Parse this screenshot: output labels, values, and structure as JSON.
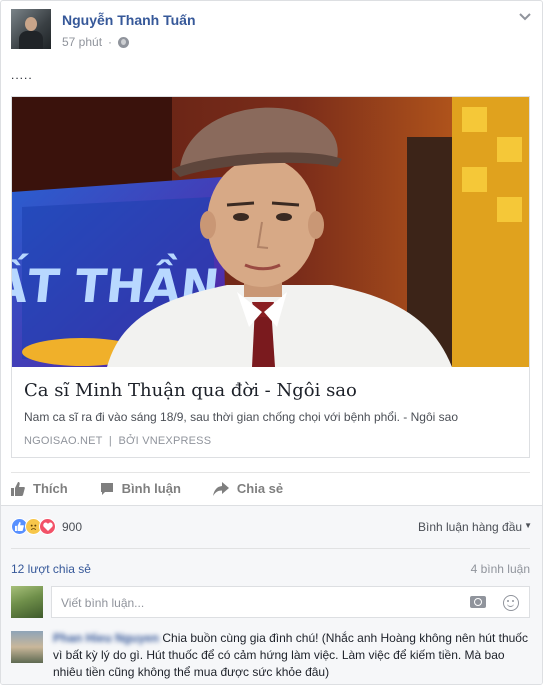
{
  "post": {
    "author": "Nguyễn Thanh Tuấn",
    "time": "57 phút",
    "text": ".....",
    "link": {
      "title": "Ca sĩ Minh Thuận qua đời - Ngôi sao",
      "description": "Nam ca sĩ ra đi vào sáng 18/9, sau thời gian chống chọi với bệnh phổi. - Ngôi sao",
      "source": "NGOISAO.NET",
      "via": "BỞI VNEXPRESS",
      "image_text": "ẤT THẦN"
    }
  },
  "actions": {
    "like": "Thích",
    "comment": "Bình luận",
    "share": "Chia sẻ"
  },
  "reactions": {
    "types": [
      "like",
      "sad",
      "love"
    ],
    "count": "900"
  },
  "sort_label": "Bình luận hàng đầu",
  "shares_label": "12 lượt chia sẻ",
  "comments_label": "4 bình luận",
  "composer_placeholder": "Viết bình luận...",
  "comment": {
    "author": "Phan Hieu Nguyen",
    "text": "Chia buồn cùng gia đình chú! (Nhắc anh Hoàng không nên hút thuốc vì bất kỳ lý do gì. Hút thuốc để có cảm hứng làm việc. Làm việc để kiếm tiền. Mà bao nhiêu tiền cũng không thể mua được sức khỏe đâu)"
  },
  "colors": {
    "link_blue": "#365899",
    "like_blue": "#5890ff",
    "love_red": "#f25268",
    "sad_yellow": "#f7c64a",
    "muted": "#90949c"
  },
  "icons": [
    "chevron-down-icon",
    "globe-icon",
    "like-icon",
    "comment-icon",
    "share-icon",
    "camera-icon",
    "emoji-icon"
  ]
}
